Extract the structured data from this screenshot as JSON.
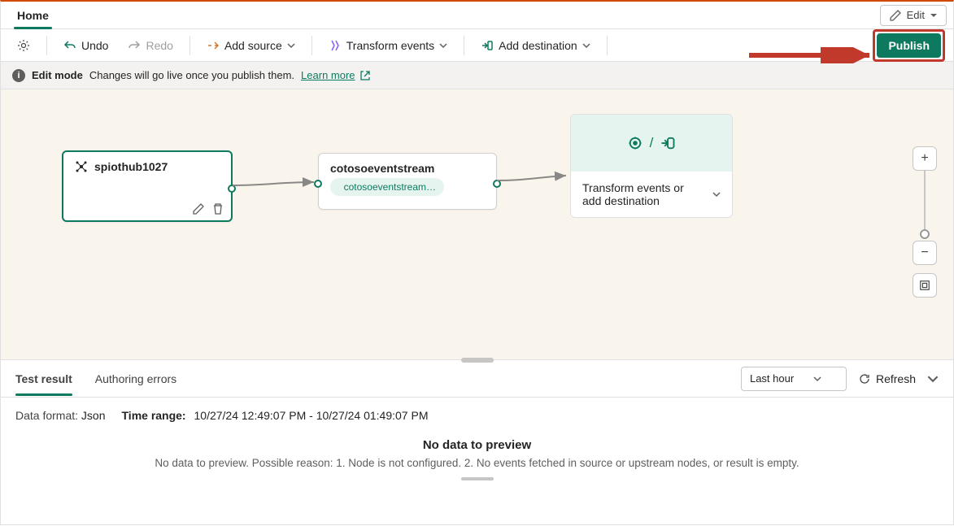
{
  "topbar": {
    "tabs": [
      "Home"
    ],
    "edit_label": "Edit"
  },
  "toolbar": {
    "undo": "Undo",
    "redo": "Redo",
    "add_source": "Add source",
    "transform_events": "Transform events",
    "add_destination": "Add destination",
    "publish": "Publish"
  },
  "infobar": {
    "mode": "Edit mode",
    "message": "Changes will go live once you publish them.",
    "learn_more": "Learn more"
  },
  "canvas": {
    "node_source": {
      "title": "spiothub1027"
    },
    "node_stream": {
      "title": "cotosoeventstream",
      "chip": "cotosoeventstream…"
    },
    "node_placeholder": {
      "label": "Transform events or add destination"
    }
  },
  "bottom": {
    "tabs": {
      "test_result": "Test result",
      "authoring_errors": "Authoring errors"
    },
    "time_select": "Last hour",
    "refresh": "Refresh",
    "data_format_label": "Data format:",
    "data_format_value": "Json",
    "time_range_label": "Time range:",
    "time_range_value": "10/27/24 12:49:07 PM - 10/27/24 01:49:07 PM",
    "empty_title": "No data to preview",
    "empty_msg": "No data to preview. Possible reason: 1. Node is not configured. 2. No events fetched in source or upstream nodes, or result is empty."
  }
}
